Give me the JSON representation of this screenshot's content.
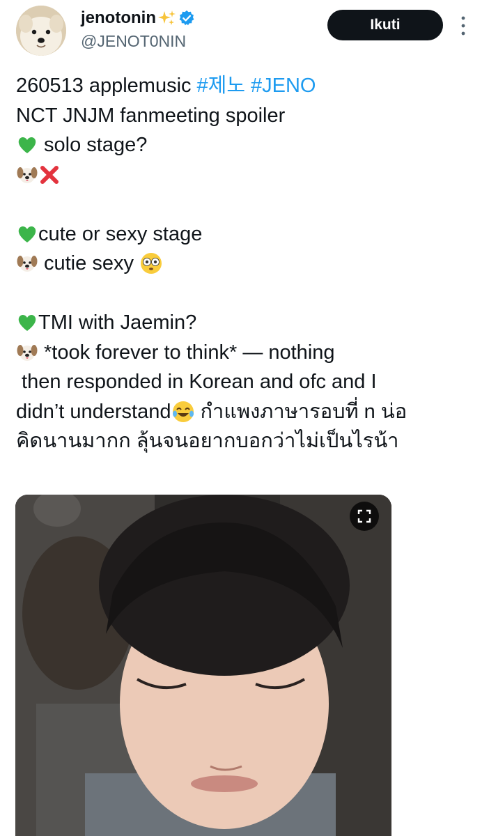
{
  "author": {
    "display_name": "jenotonin",
    "handle": "@JENOT0NIN",
    "verified": true,
    "name_emoji": "sparkles-icon"
  },
  "actions": {
    "follow_label": "Ikuti",
    "more_icon": "more-vertical-icon"
  },
  "tweet": {
    "line1_text": "260513 applemusic",
    "hashtag1": "#제노",
    "hashtag2": "#JENO",
    "line2": "NCT JNJM fanmeeting spoiler",
    "line3": "solo stage?",
    "line5": "cute or sexy stage",
    "line6": "cutie sexy",
    "line8": "TMI with Jaemin?",
    "line9": "*took forever to think* — nothing",
    "line10": " then responded in Korean and ofc and I",
    "line11a": "didn’t understand",
    "line11b": "กำแพงภาษารอบที่ n น่อ",
    "line12": "คิดนานมากก ลุ้นจนอยากบอกว่าไม่เป็นไรน้า"
  },
  "media": {
    "expand_icon": "expand-icon"
  },
  "colors": {
    "link": "#1d9bf0",
    "text": "#0f1419",
    "secondary": "#536471",
    "button_bg": "#0f1419"
  }
}
